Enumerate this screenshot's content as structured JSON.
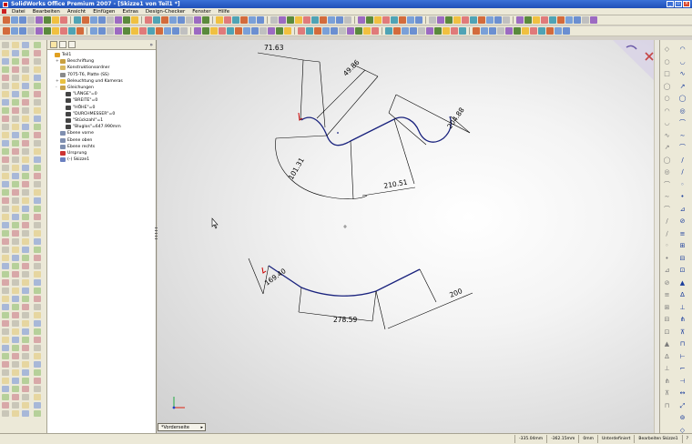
{
  "window": {
    "title": "SolidWorks Office Premium 2007 - [Skizze1 von Teil1 *]"
  },
  "menu": {
    "items": [
      "Datei",
      "Bearbeiten",
      "Ansicht",
      "Einfügen",
      "Extras",
      "Design-Checker",
      "Fenster",
      "Hilfe"
    ]
  },
  "feature_tree": {
    "items": [
      {
        "label": "Teil1",
        "icon": "part-icon",
        "indent": 0,
        "pm": ""
      },
      {
        "label": "Beschriftung",
        "icon": "annotation-icon",
        "indent": 1,
        "pm": "+"
      },
      {
        "label": "Konstruktionsordner",
        "icon": "design-folder-icon",
        "indent": 1,
        "pm": ""
      },
      {
        "label": "7075-T6, Platte (SS)",
        "icon": "material-icon",
        "indent": 1,
        "pm": ""
      },
      {
        "label": "Beleuchtung und Kameras",
        "icon": "lights-icon",
        "indent": 1,
        "pm": "+"
      },
      {
        "label": "Gleichungen",
        "icon": "equations-icon",
        "indent": 1,
        "pm": "-"
      },
      {
        "label": "\"LÄNGE\"=0",
        "icon": "equation-icon",
        "indent": 2,
        "pm": ""
      },
      {
        "label": "\"BREITE\"=0",
        "icon": "equation-icon",
        "indent": 2,
        "pm": ""
      },
      {
        "label": "\"HÖHE\"=0",
        "icon": "equation-icon",
        "indent": 2,
        "pm": ""
      },
      {
        "label": "\"DURCHMESSER\"=0",
        "icon": "equation-icon",
        "indent": 2,
        "pm": ""
      },
      {
        "label": "\"Stückzahl\"=1",
        "icon": "equation-icon",
        "indent": 2,
        "pm": ""
      },
      {
        "label": "\"Bluglos\"=647.990mm",
        "icon": "equation-icon",
        "indent": 2,
        "pm": ""
      },
      {
        "label": "Ebene vorne",
        "icon": "plane-icon",
        "indent": 1,
        "pm": ""
      },
      {
        "label": "Ebene oben",
        "icon": "plane-icon",
        "indent": 1,
        "pm": ""
      },
      {
        "label": "Ebene rechts",
        "icon": "plane-icon",
        "indent": 1,
        "pm": ""
      },
      {
        "label": "Ursprung",
        "icon": "origin-icon",
        "indent": 1,
        "pm": ""
      },
      {
        "label": "(-) Skizze1",
        "icon": "sketch-icon",
        "indent": 1,
        "pm": ""
      }
    ]
  },
  "dimensions": {
    "d1": "71.63",
    "d2": "49.86",
    "d3": "204.88",
    "d4": "101.31",
    "d5": "210.51",
    "d6": "169.40",
    "d7": "278.59",
    "d8": "200"
  },
  "view_tab": {
    "label": "*Vorderseite"
  },
  "status": {
    "x": "-335.04mm",
    "y": "-362.15mm",
    "z": "0mm",
    "state": "Unterdefiniert",
    "mode": "Bearbeiten Skizze1"
  },
  "colors": {
    "sketch_blue": "#1a237e",
    "constraint_red": "#cc0000"
  }
}
